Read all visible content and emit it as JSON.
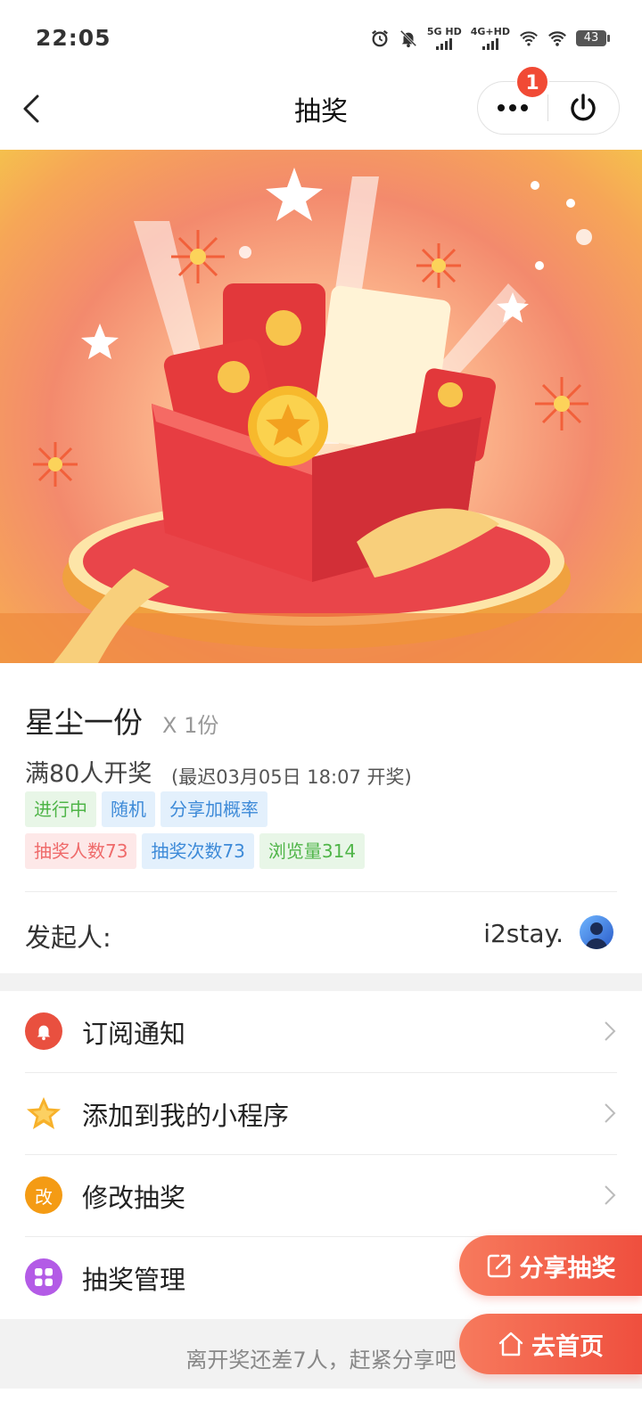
{
  "status_bar": {
    "time": "22:05",
    "net1_label": "5G HD",
    "net2_label": "4G+HD",
    "battery": "43"
  },
  "nav": {
    "title": "抽奖",
    "badge_count": "1"
  },
  "prize": {
    "name": "星尘一份",
    "quantity": "X 1份",
    "condition": "满80人开奖",
    "latest_time": "(最迟03月05日 18:07 开奖)"
  },
  "tags": {
    "status": "进行中",
    "mode": "随机",
    "share_bonus": "分享加概率",
    "participants": "抽奖人数73",
    "draws": "抽奖次数73",
    "views": "浏览量314"
  },
  "initiator": {
    "label": "发起人:",
    "name": "i2stay."
  },
  "menu": [
    {
      "label": "订阅通知",
      "icon": "bell-icon",
      "color": "#e9503f"
    },
    {
      "label": "添加到我的小程序",
      "icon": "star-icon",
      "color": "#f7b12a"
    },
    {
      "label": "修改抽奖",
      "icon": "edit-icon",
      "icon_text": "改",
      "color": "#f49b14"
    },
    {
      "label": "抽奖管理",
      "icon": "grid-icon",
      "color": "#b35be6"
    }
  ],
  "tip": "离开奖还差7人，赶紧分享吧",
  "buttons": {
    "share": "分享抽奖",
    "home": "去首页"
  },
  "colors": {
    "accent": "#ef4f3e",
    "tag_green": "#4fb548",
    "tag_blue": "#3d8ad8",
    "tag_red": "#ef6a6a"
  }
}
